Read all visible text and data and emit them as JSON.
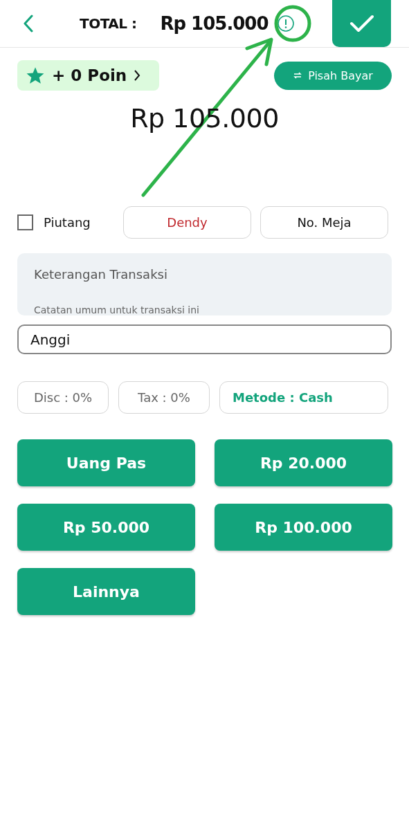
{
  "header": {
    "total_label": "TOTAL :",
    "total_amount": "Rp 105.000"
  },
  "points": {
    "label": "+ 0 Poin"
  },
  "split_button": "Pisah Bayar",
  "amount": "Rp 105.000",
  "debt_checkbox": {
    "label": "Piutang",
    "checked": false
  },
  "customer_button": "Dendy",
  "table_button": "No. Meja",
  "note_field": {
    "placeholder": "Keterangan Transaksi",
    "hint": "Catatan umum untuk transaksi ini"
  },
  "name_field": {
    "value": "Anggi"
  },
  "chips": [
    {
      "label": "Disc : 0%",
      "kind": "plain"
    },
    {
      "label": "Tax : 0%",
      "kind": "plain"
    },
    {
      "label": "Metode : Cash",
      "kind": "method"
    }
  ],
  "cash_buttons": [
    "Uang Pas",
    "Rp 20.000",
    "Rp 50.000",
    "Rp 100.000",
    "Lainnya"
  ]
}
